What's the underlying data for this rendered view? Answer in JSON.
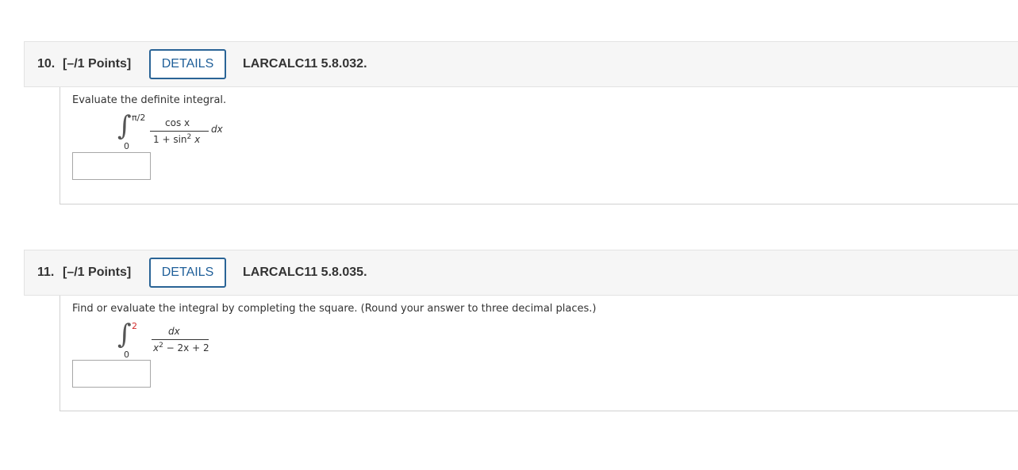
{
  "questions": [
    {
      "number": "10.",
      "points": "[–/1 Points]",
      "details_label": "DETAILS",
      "code": "LARCALC11 5.8.032.",
      "prompt": "Evaluate the definite integral.",
      "integral": {
        "upper_limit": "π/2",
        "lower_limit": "0",
        "numerator": "cos x",
        "denominator_base": "1 + sin",
        "denominator_exp": "2",
        "denominator_tail": "x",
        "differential": "dx"
      },
      "answer_value": ""
    },
    {
      "number": "11.",
      "points": "[–/1 Points]",
      "details_label": "DETAILS",
      "code": "LARCALC11 5.8.035.",
      "prompt": "Find or evaluate the integral by completing the square. (Round your answer to three decimal places.)",
      "integral": {
        "upper_limit": "2",
        "lower_limit": "0",
        "numerator": "dx",
        "denominator_base": "x",
        "denominator_exp": "2",
        "denominator_tail": "− 2x + 2"
      },
      "answer_value": ""
    }
  ],
  "colors": {
    "accent": "#1f5f99",
    "upper_limit_highlight": "#d12a2a"
  }
}
